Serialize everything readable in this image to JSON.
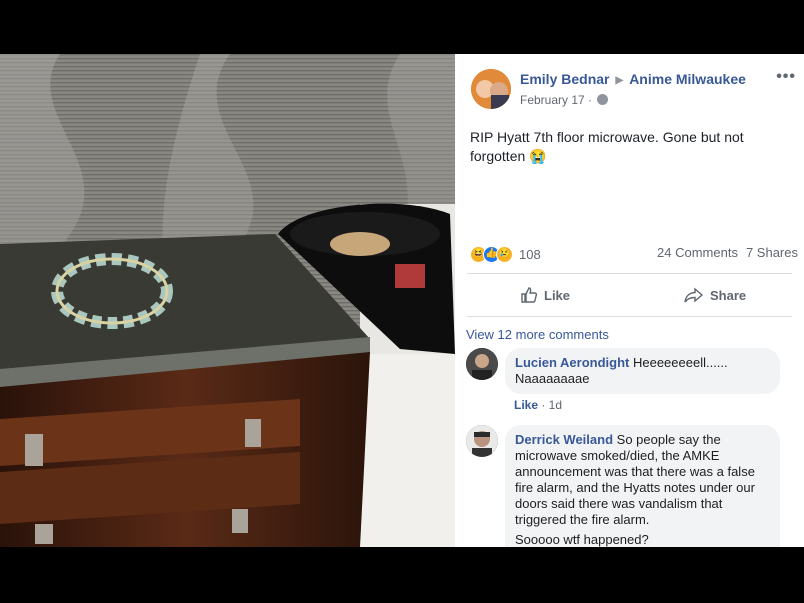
{
  "post": {
    "author": "Emily Bednar",
    "group": "Anime Milwaukee",
    "date": "February 17 ·",
    "text": "RIP Hyatt 7th floor microwave. Gone but not forgotten 😭",
    "more_icon": "ellipsis-icon"
  },
  "stats": {
    "reaction_count": "108",
    "comments": "24 Comments",
    "shares": "7 Shares",
    "reaction_icons": [
      "haha-icon",
      "like-icon",
      "sad-icon"
    ]
  },
  "actions": {
    "like": "Like",
    "share": "Share"
  },
  "comments_section": {
    "view_more": "View 12 more comments",
    "items": [
      {
        "name": "Lucien Aerondight",
        "text": " Heeeeeeeell...... Naaaaaaaae",
        "like": "Like",
        "time": " · 1d"
      },
      {
        "name": "Derrick Weiland",
        "text": " So people say the microwave smoked/died, the AMKE announcement was that there was a false fire alarm, and the Hyatts notes under our doors said there was vandalism that triggered the fire alarm.",
        "more": "Sooooo wtf happened?"
      }
    ]
  },
  "colors": {
    "link_blue": "#385898",
    "bubble_bg": "#f2f3f5",
    "divider": "#dadde1"
  }
}
